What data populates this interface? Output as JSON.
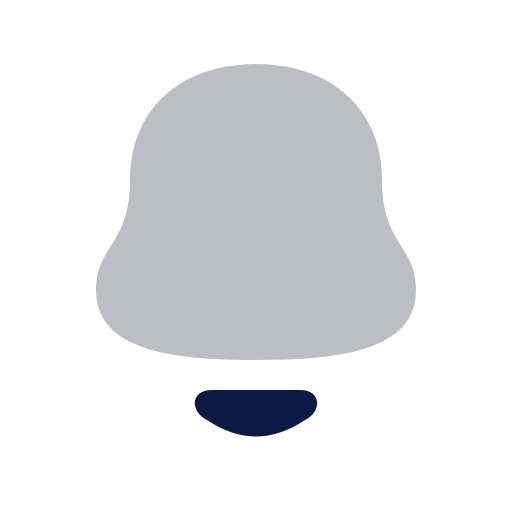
{
  "icon": {
    "name": "bell-icon",
    "colors": {
      "background": "#ffffff",
      "bell_body": "#bcbec4",
      "clapper": "#0b1a45"
    }
  }
}
